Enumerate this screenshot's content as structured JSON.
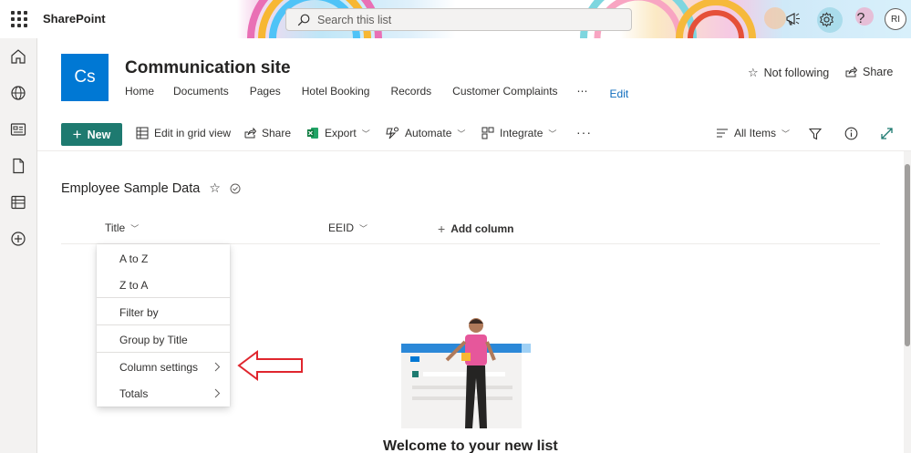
{
  "suite": {
    "app_name": "SharePoint",
    "search_placeholder": "Search this list",
    "user_initials": "RI"
  },
  "site": {
    "logo_text": "Cs",
    "title": "Communication site",
    "nav": [
      "Home",
      "Documents",
      "Pages",
      "Hotel Booking",
      "Records",
      "Customer Complaints",
      "⋯",
      "Edit"
    ],
    "follow_label": "Not following",
    "share_label": "Share"
  },
  "commands": {
    "new_label": "New",
    "grid_label": "Edit in grid view",
    "share_label": "Share",
    "export_label": "Export",
    "automate_label": "Automate",
    "integrate_label": "Integrate",
    "more_label": "···",
    "view_label": "All Items"
  },
  "list": {
    "title": "Employee Sample Data",
    "columns": [
      "Title",
      "EEID"
    ],
    "add_column_label": "Add column",
    "empty_heading": "Welcome to your new list"
  },
  "menu": {
    "items": [
      "A to Z",
      "Z to A",
      "Filter by",
      "Group by Title",
      "Column settings",
      "Totals"
    ]
  },
  "colors": {
    "accent": "#1e7a70",
    "site_logo": "#0078d4",
    "annotation_arrow": "#e0262e"
  }
}
